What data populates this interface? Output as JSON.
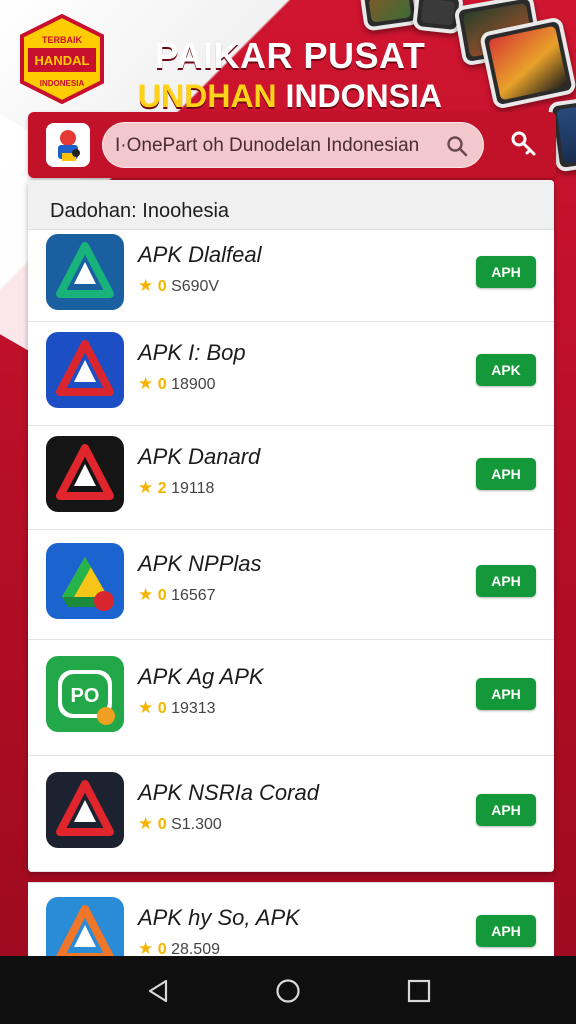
{
  "header": {
    "badge_text_top": "TERBAIK",
    "badge_text_mid": "HANDAL",
    "badge_text_bot": "INDONESIA",
    "title_line1": "PAIKAR PUSAT",
    "title_line2_yellow": "UNDHAN",
    "title_line2_white": "INDONSIA"
  },
  "search": {
    "placeholder": "I·OnePart oh Dunodelan Indonesian"
  },
  "section": {
    "title": "Dadohan: Inoohesia"
  },
  "apps": [
    {
      "name": "APK Dlalfeal",
      "rating": "0",
      "downloads": "S690V",
      "button": "APH",
      "icon_colors": [
        "#1a5fa0",
        "#17b37b"
      ]
    },
    {
      "name": "APK I: Bop",
      "rating": "0",
      "downloads": "18900",
      "button": "APK",
      "icon_colors": [
        "#1d4fc4",
        "#d9262e"
      ]
    },
    {
      "name": "APK Danard",
      "rating": "2",
      "downloads": "19118",
      "button": "APH",
      "icon_colors": [
        "#151515",
        "#e0252c"
      ]
    },
    {
      "name": "APK NPPlas",
      "rating": "0",
      "downloads": "16567",
      "button": "APH",
      "icon_colors": [
        "#1b64cf",
        "#26b34a"
      ]
    },
    {
      "name": "APK Ag APK",
      "rating": "0",
      "downloads": "19313",
      "button": "APH",
      "icon_colors": [
        "#22a848",
        "#ffffff"
      ]
    },
    {
      "name": "APK NSRIa Corad",
      "rating": "0",
      "downloads": "S1.300",
      "button": "APH",
      "icon_colors": [
        "#1c2230",
        "#e0252c"
      ]
    },
    {
      "name": "APK hy So, APK",
      "rating": "0",
      "downloads": "28.509",
      "button": "APH",
      "icon_colors": [
        "#2a8bd6",
        "#f0762a"
      ]
    }
  ],
  "colors": {
    "brand_red": "#c8102e",
    "accent_yellow": "#ffd21a",
    "button_green": "#14993a"
  }
}
